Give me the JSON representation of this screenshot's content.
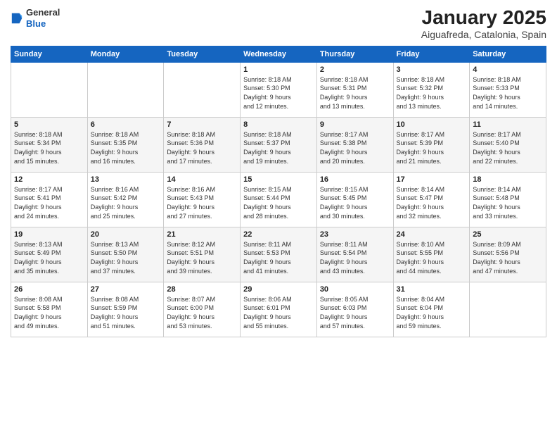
{
  "logo": {
    "general": "General",
    "blue": "Blue"
  },
  "title": "January 2025",
  "subtitle": "Aiguafreda, Catalonia, Spain",
  "days_of_week": [
    "Sunday",
    "Monday",
    "Tuesday",
    "Wednesday",
    "Thursday",
    "Friday",
    "Saturday"
  ],
  "weeks": [
    [
      {
        "day": "",
        "info": ""
      },
      {
        "day": "",
        "info": ""
      },
      {
        "day": "",
        "info": ""
      },
      {
        "day": "1",
        "info": "Sunrise: 8:18 AM\nSunset: 5:30 PM\nDaylight: 9 hours\nand 12 minutes."
      },
      {
        "day": "2",
        "info": "Sunrise: 8:18 AM\nSunset: 5:31 PM\nDaylight: 9 hours\nand 13 minutes."
      },
      {
        "day": "3",
        "info": "Sunrise: 8:18 AM\nSunset: 5:32 PM\nDaylight: 9 hours\nand 13 minutes."
      },
      {
        "day": "4",
        "info": "Sunrise: 8:18 AM\nSunset: 5:33 PM\nDaylight: 9 hours\nand 14 minutes."
      }
    ],
    [
      {
        "day": "5",
        "info": "Sunrise: 8:18 AM\nSunset: 5:34 PM\nDaylight: 9 hours\nand 15 minutes."
      },
      {
        "day": "6",
        "info": "Sunrise: 8:18 AM\nSunset: 5:35 PM\nDaylight: 9 hours\nand 16 minutes."
      },
      {
        "day": "7",
        "info": "Sunrise: 8:18 AM\nSunset: 5:36 PM\nDaylight: 9 hours\nand 17 minutes."
      },
      {
        "day": "8",
        "info": "Sunrise: 8:18 AM\nSunset: 5:37 PM\nDaylight: 9 hours\nand 19 minutes."
      },
      {
        "day": "9",
        "info": "Sunrise: 8:17 AM\nSunset: 5:38 PM\nDaylight: 9 hours\nand 20 minutes."
      },
      {
        "day": "10",
        "info": "Sunrise: 8:17 AM\nSunset: 5:39 PM\nDaylight: 9 hours\nand 21 minutes."
      },
      {
        "day": "11",
        "info": "Sunrise: 8:17 AM\nSunset: 5:40 PM\nDaylight: 9 hours\nand 22 minutes."
      }
    ],
    [
      {
        "day": "12",
        "info": "Sunrise: 8:17 AM\nSunset: 5:41 PM\nDaylight: 9 hours\nand 24 minutes."
      },
      {
        "day": "13",
        "info": "Sunrise: 8:16 AM\nSunset: 5:42 PM\nDaylight: 9 hours\nand 25 minutes."
      },
      {
        "day": "14",
        "info": "Sunrise: 8:16 AM\nSunset: 5:43 PM\nDaylight: 9 hours\nand 27 minutes."
      },
      {
        "day": "15",
        "info": "Sunrise: 8:15 AM\nSunset: 5:44 PM\nDaylight: 9 hours\nand 28 minutes."
      },
      {
        "day": "16",
        "info": "Sunrise: 8:15 AM\nSunset: 5:45 PM\nDaylight: 9 hours\nand 30 minutes."
      },
      {
        "day": "17",
        "info": "Sunrise: 8:14 AM\nSunset: 5:47 PM\nDaylight: 9 hours\nand 32 minutes."
      },
      {
        "day": "18",
        "info": "Sunrise: 8:14 AM\nSunset: 5:48 PM\nDaylight: 9 hours\nand 33 minutes."
      }
    ],
    [
      {
        "day": "19",
        "info": "Sunrise: 8:13 AM\nSunset: 5:49 PM\nDaylight: 9 hours\nand 35 minutes."
      },
      {
        "day": "20",
        "info": "Sunrise: 8:13 AM\nSunset: 5:50 PM\nDaylight: 9 hours\nand 37 minutes."
      },
      {
        "day": "21",
        "info": "Sunrise: 8:12 AM\nSunset: 5:51 PM\nDaylight: 9 hours\nand 39 minutes."
      },
      {
        "day": "22",
        "info": "Sunrise: 8:11 AM\nSunset: 5:53 PM\nDaylight: 9 hours\nand 41 minutes."
      },
      {
        "day": "23",
        "info": "Sunrise: 8:11 AM\nSunset: 5:54 PM\nDaylight: 9 hours\nand 43 minutes."
      },
      {
        "day": "24",
        "info": "Sunrise: 8:10 AM\nSunset: 5:55 PM\nDaylight: 9 hours\nand 44 minutes."
      },
      {
        "day": "25",
        "info": "Sunrise: 8:09 AM\nSunset: 5:56 PM\nDaylight: 9 hours\nand 47 minutes."
      }
    ],
    [
      {
        "day": "26",
        "info": "Sunrise: 8:08 AM\nSunset: 5:58 PM\nDaylight: 9 hours\nand 49 minutes."
      },
      {
        "day": "27",
        "info": "Sunrise: 8:08 AM\nSunset: 5:59 PM\nDaylight: 9 hours\nand 51 minutes."
      },
      {
        "day": "28",
        "info": "Sunrise: 8:07 AM\nSunset: 6:00 PM\nDaylight: 9 hours\nand 53 minutes."
      },
      {
        "day": "29",
        "info": "Sunrise: 8:06 AM\nSunset: 6:01 PM\nDaylight: 9 hours\nand 55 minutes."
      },
      {
        "day": "30",
        "info": "Sunrise: 8:05 AM\nSunset: 6:03 PM\nDaylight: 9 hours\nand 57 minutes."
      },
      {
        "day": "31",
        "info": "Sunrise: 8:04 AM\nSunset: 6:04 PM\nDaylight: 9 hours\nand 59 minutes."
      },
      {
        "day": "",
        "info": ""
      }
    ]
  ]
}
